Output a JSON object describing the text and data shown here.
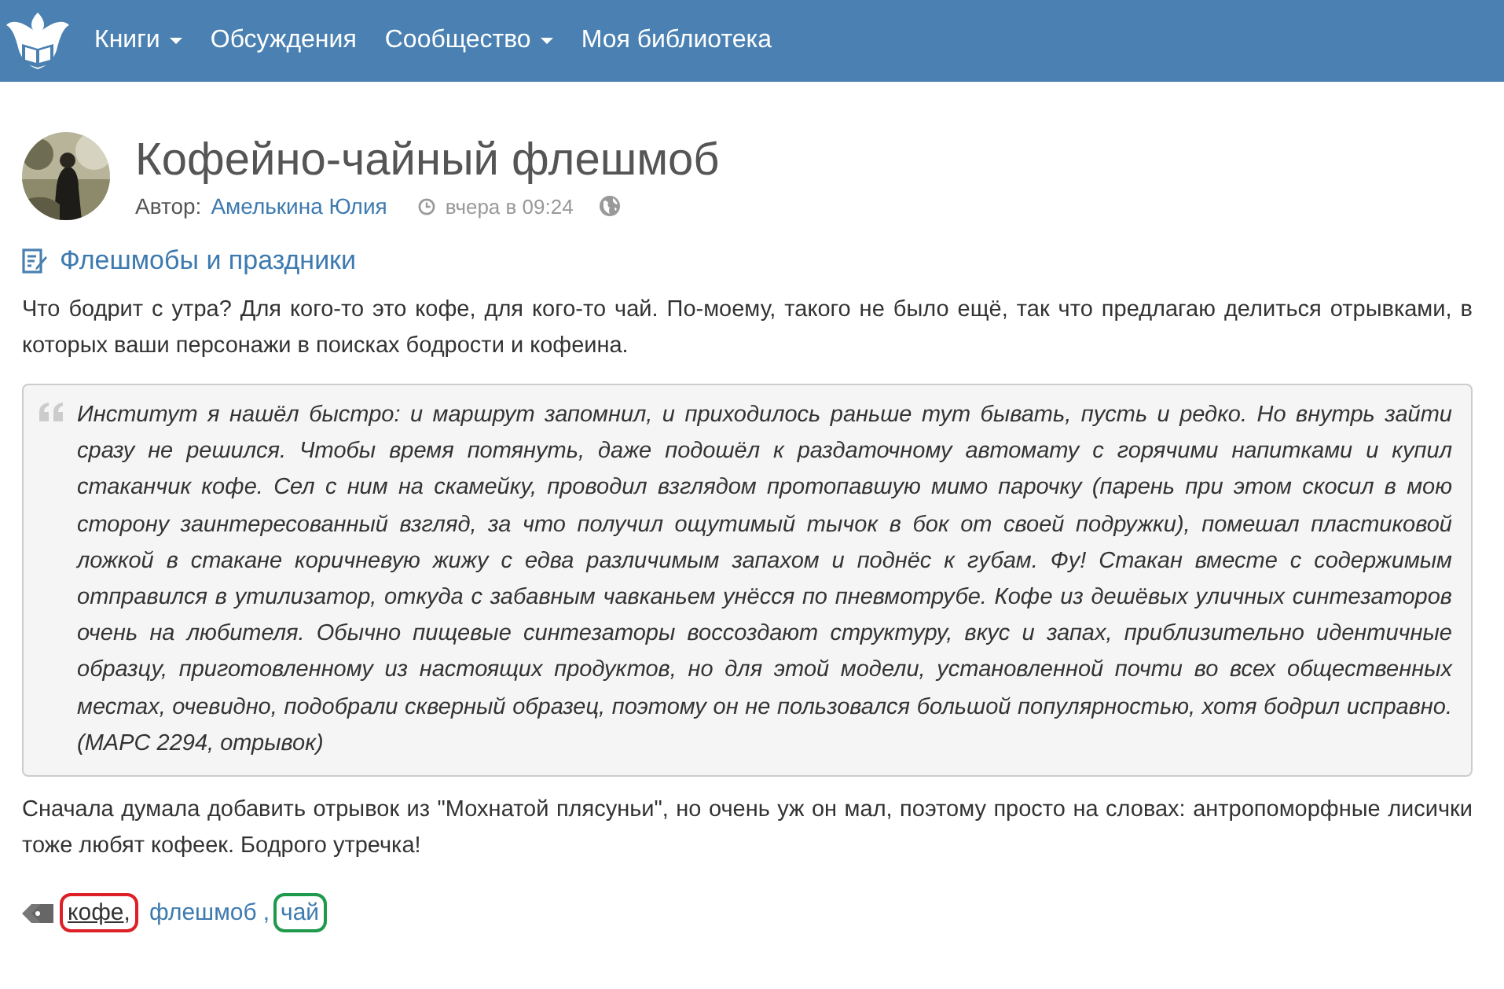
{
  "navbar": {
    "items": [
      {
        "label": "Книги",
        "dropdown": true
      },
      {
        "label": "Обсуждения",
        "dropdown": false
      },
      {
        "label": "Сообщество",
        "dropdown": true
      },
      {
        "label": "Моя библиотека",
        "dropdown": false
      }
    ]
  },
  "post": {
    "title": "Кофейно-чайный флешмоб",
    "author_label": "Автор:",
    "author": "Амелькина Юлия",
    "time": "вчера в 09:24",
    "category": "Флешмобы и праздники",
    "intro": "Что бодрит с утра? Для кого-то это кофе, для кого-то чай. По-моему, такого не было ещё, так что предлагаю делиться отрывками, в которых ваши персонажи в поисках бодрости и кофеина.",
    "quote": "Институт я нашёл быстро: и маршрут запомнил, и приходилось раньше тут бывать, пусть и редко. Но внутрь зайти сразу не решился. Чтобы время потянуть, даже подошёл к раздаточному автомату с горячими напитками и купил стаканчик кофе. Сел с ним на скамейку, проводил взглядом протопавшую мимо парочку (парень при этом скосил в мою сторону заинтересованный взгляд, за что получил ощутимый тычок в бок от своей подружки), помешал пластиковой ложкой в стакане коричневую жижу с едва различимым запахом и поднёс к губам. Фу! Стакан вместе с содержимым отправился в утилизатор, откуда с забавным чавканьем унёсся по пневмотрубе. Кофе из дешёвых уличных синтезаторов очень на любителя. Обычно пищевые синтезаторы воссоздают структуру, вкус и запах, приблизительно идентичные образцу, приготовленному из настоящих продуктов, но для этой модели, установленной почти во всех общественных местах, очевидно, подобрали скверный образец, поэтому он не пользовался большой популярностью, хотя бодрил исправно. (МАРС 2294, отрывок)",
    "outro": "Сначала думала добавить отрывок из \"Мохнатой плясуньи\", но очень уж он мал, поэтому просто на словах: антропоморфные лисички тоже любят кофеек. Бодрого утречка!",
    "tags": [
      {
        "label": "кофе",
        "separator": ",",
        "underlined": true,
        "color": "#dd1f26"
      },
      {
        "label": "флешмоб",
        "separator": ",",
        "underlined": false
      },
      {
        "label": "чай",
        "underlined": false,
        "color": "#1f9a4c"
      }
    ]
  }
}
